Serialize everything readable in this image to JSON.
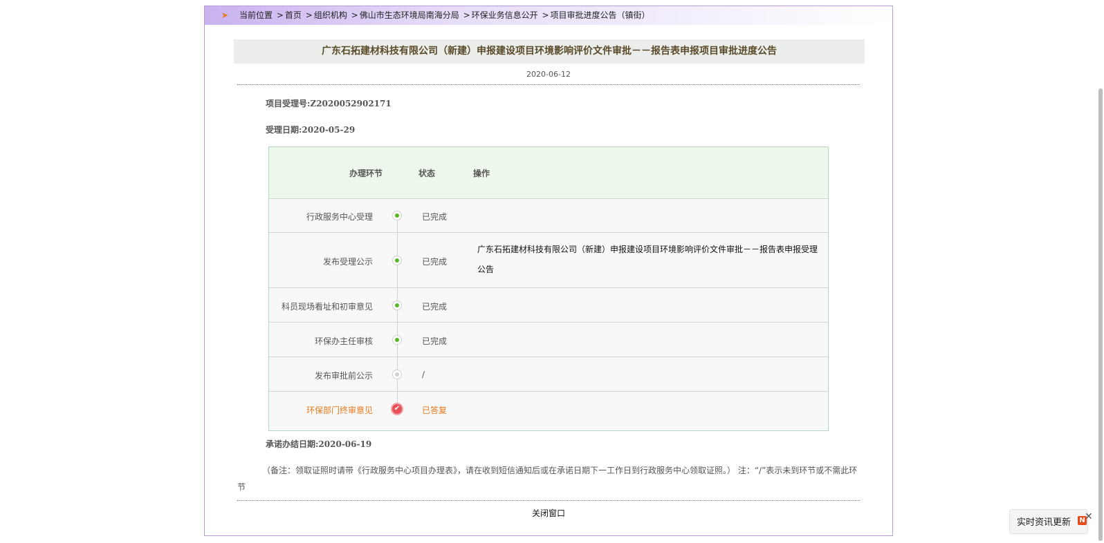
{
  "breadcrumb": {
    "prefix": "当前位置",
    "items": [
      "首页",
      "组织机构",
      "佛山市生态环境局南海分局",
      "环保业务信息公开",
      "项目审批进度公告（镇街）"
    ]
  },
  "notice": {
    "title": "广东石拓建材科技有限公司（新建）申报建设项目环境影响评价文件审批－－报告表申报项目审批进度公告",
    "date": "2020-06-12",
    "project_no": "项目受理号:Z2020052902171",
    "accept_date": "受理日期:2020-05-29",
    "promise_date": "承诺办结日期:2020-06-19",
    "note": "（备注：领取证照时请带《行政服务中心项目办理表》，请在收到短信通知后或在承诺日期下一工作日到行政服务中心领取证照。） 注：“/”表示未到环节或不需此环节",
    "close_label": "关闭窗口"
  },
  "table": {
    "headers": [
      "办理环节",
      "状态",
      "操作"
    ],
    "rows": [
      {
        "step": "行政服务中心受理",
        "status": "已完成",
        "op": ""
      },
      {
        "step": "发布受理公示",
        "status": "已完成",
        "op": "广东石拓建材科技有限公司（新建）申报建设项目环境影响评价文件审批－－报告表申报受理公告"
      },
      {
        "step": "科员现场看址和初审意见",
        "status": "已完成",
        "op": ""
      },
      {
        "step": "环保办主任审核",
        "status": "已完成",
        "op": ""
      },
      {
        "step": "发布审批前公示",
        "status": "/",
        "op": ""
      },
      {
        "step": "环保部门终审意见",
        "status": "已答复",
        "op": ""
      }
    ]
  },
  "float_widget": {
    "label": "实时资讯更新",
    "badge": "N",
    "close_glyph": "✕"
  },
  "colors": {
    "accent": "#e8791b",
    "done": "#56b81f",
    "final": "#e85058",
    "frame_border": "#b79ad8"
  }
}
